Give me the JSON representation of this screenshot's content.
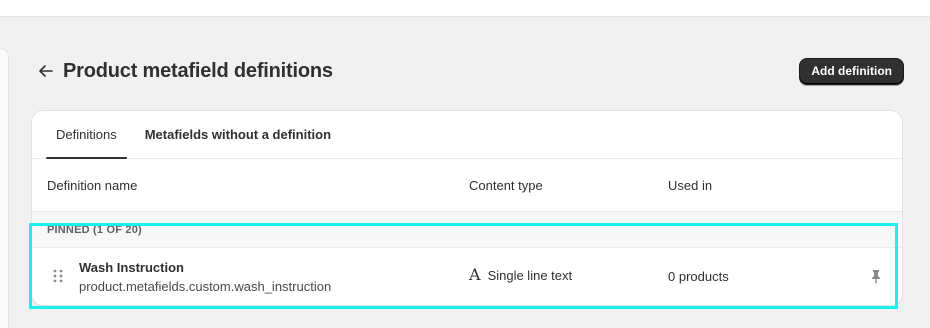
{
  "header": {
    "title": "Product metafield definitions",
    "add_button_label": "Add definition"
  },
  "tabs": [
    {
      "label": "Definitions",
      "active": true
    },
    {
      "label": "Metafields without a definition",
      "active": false
    }
  ],
  "table": {
    "columns": [
      "Definition name",
      "Content type",
      "Used in"
    ],
    "section_label": "PINNED (1 OF 20)",
    "rows": [
      {
        "name": "Wash Instruction",
        "key": "product.metafields.custom.wash_instruction",
        "content_type": "Single line text",
        "content_type_icon": "text-type-icon",
        "used_in": "0 products",
        "pinned": true
      }
    ]
  },
  "colors": {
    "primary_button": "#303030",
    "highlight": "#19f0f0",
    "background": "#f1f1f1"
  }
}
